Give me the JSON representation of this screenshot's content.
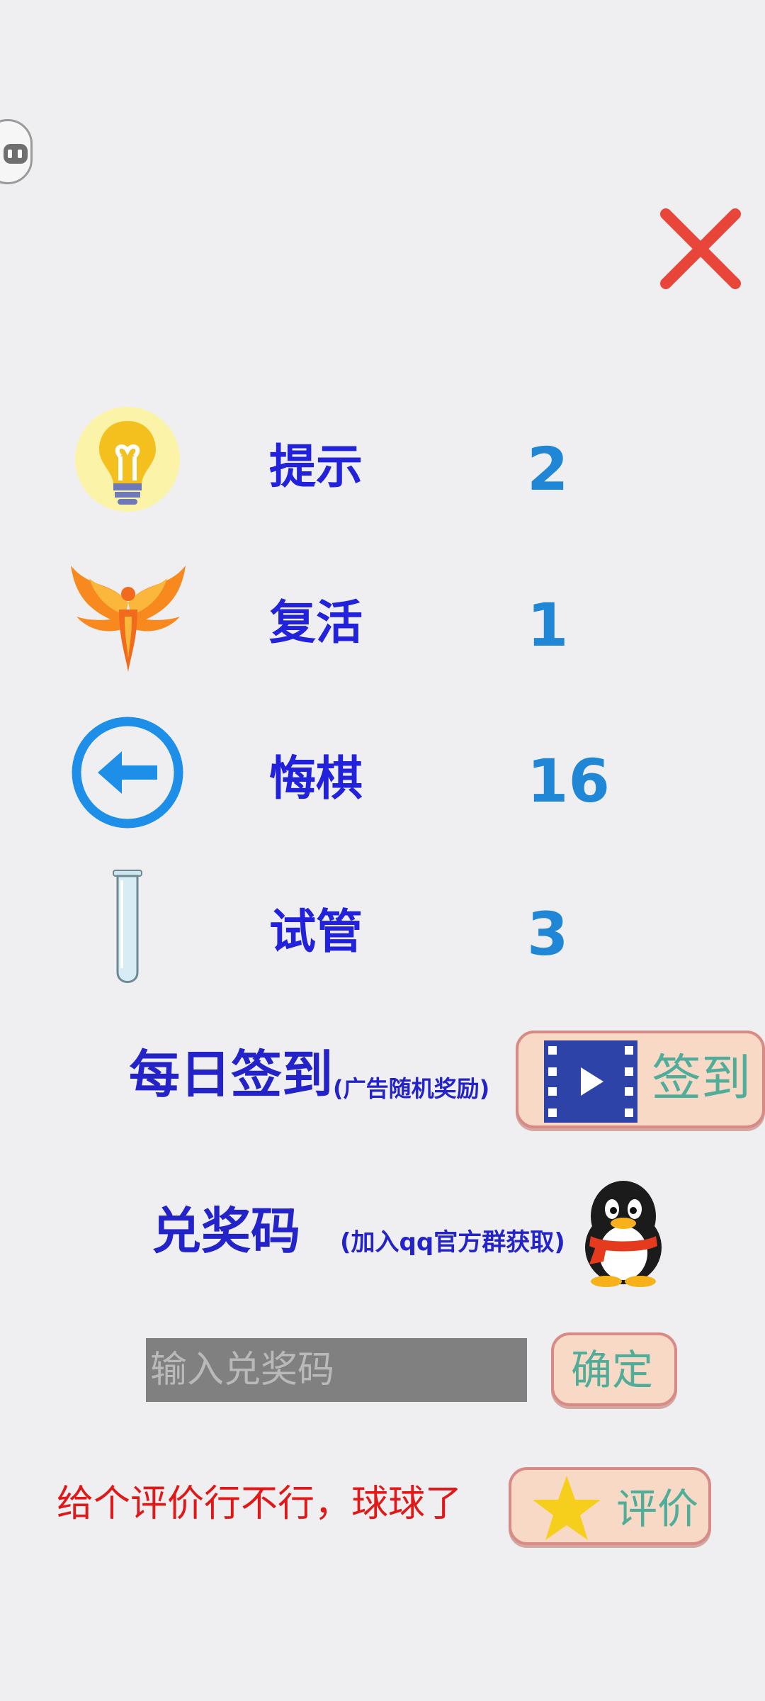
{
  "items": [
    {
      "label": "提示",
      "count": "2",
      "icon": "lightbulb-icon"
    },
    {
      "label": "复活",
      "count": "1",
      "icon": "phoenix-icon"
    },
    {
      "label": "悔棋",
      "count": "16",
      "icon": "undo-arrow-icon"
    },
    {
      "label": "试管",
      "count": "3",
      "icon": "test-tube-icon"
    }
  ],
  "signin": {
    "title": "每日签到",
    "note": "(广告随机奖励)",
    "button_label": "签到",
    "button_icon": "video-play-icon"
  },
  "redeem": {
    "title": "兑奖码",
    "note": "(加入qq官方群获取)",
    "icon": "qq-penguin-icon",
    "input_placeholder": "输入兑奖码",
    "confirm_label": "确定"
  },
  "rate": {
    "text": "给个评价行不行，球球了",
    "button_label": "评价",
    "button_icon": "star-icon"
  },
  "colors": {
    "label": "#2222dd",
    "count": "#1f87d6",
    "button_text": "#4fad9a",
    "rate_text": "#e01818",
    "close": "#e8463a"
  }
}
